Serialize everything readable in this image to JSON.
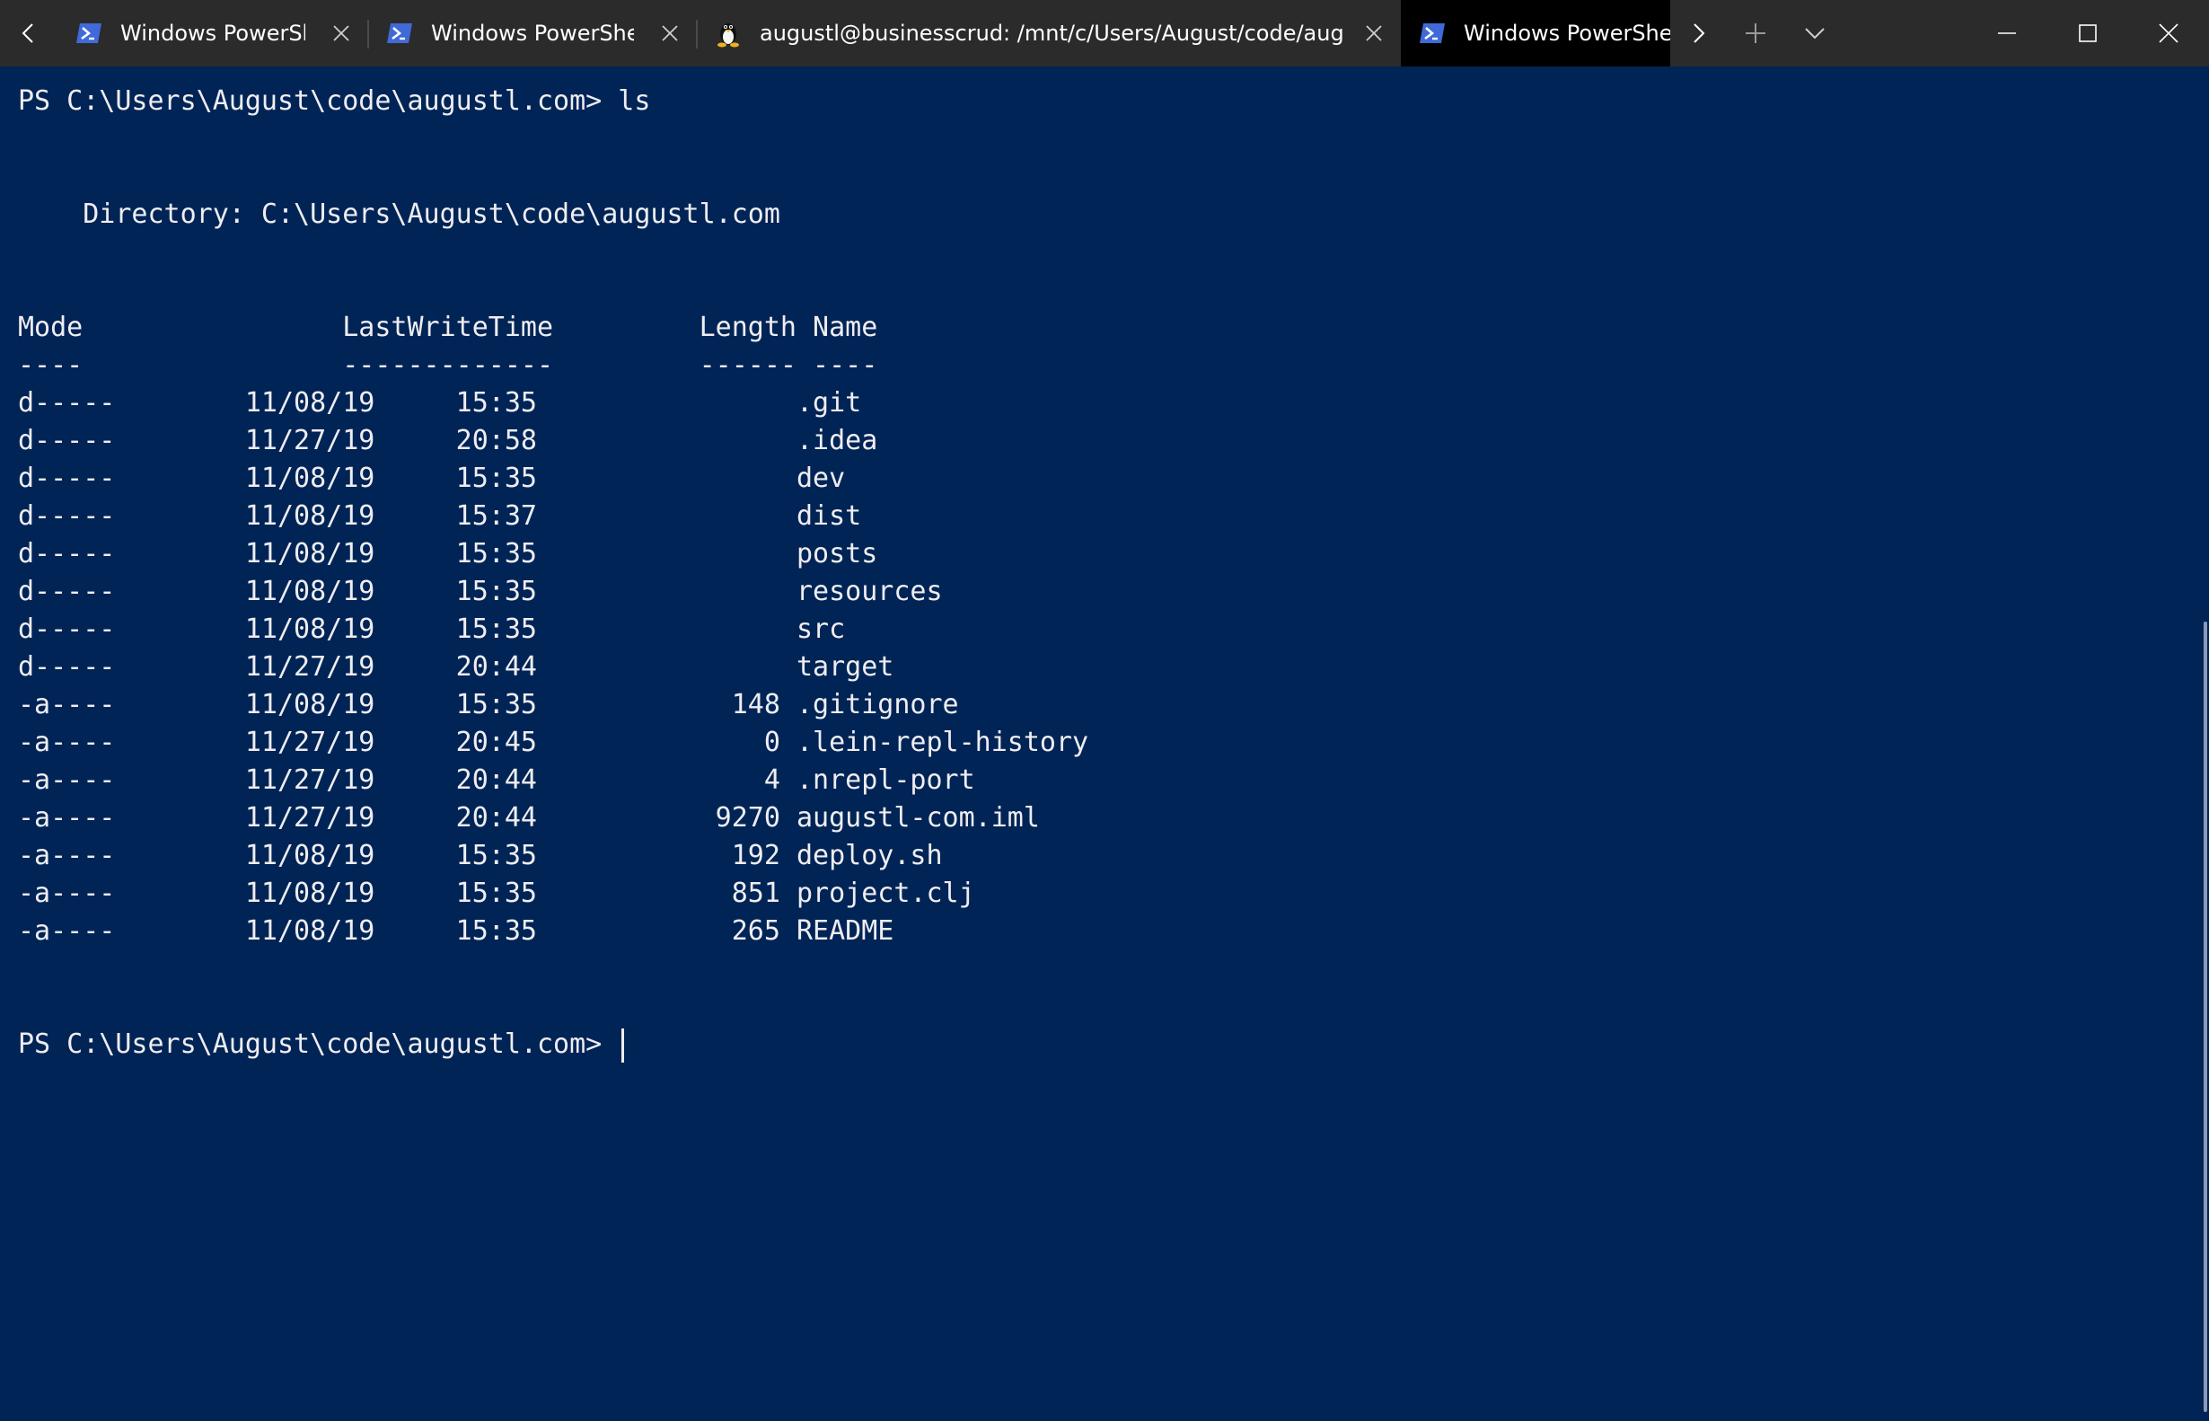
{
  "tabs": [
    {
      "title": "Windows PowerShell",
      "icon": "powershell-icon",
      "active": false
    },
    {
      "title": "Windows PowerShell",
      "icon": "powershell-icon",
      "active": false
    },
    {
      "title": "augustl@businesscrud: /mnt/c/Users/August/code/augustl.com",
      "icon": "linux-tux-icon",
      "active": false
    },
    {
      "title": "Windows PowerShell",
      "icon": "powershell-icon",
      "active": true
    }
  ],
  "colors": {
    "terminal_bg": "#012456",
    "terminal_fg": "#eeedf0",
    "titlebar_bg": "#2b2b2b",
    "active_tab_bg": "#000000",
    "powershell_icon": "#3f6ad8"
  },
  "terminal": {
    "lines": [
      "PS C:\\Users\\August\\code\\augustl.com> ls",
      "",
      "",
      "    Directory: C:\\Users\\August\\code\\augustl.com",
      "",
      "",
      "Mode                LastWriteTime         Length Name",
      "----                -------------         ------ ----",
      "d-----        11/08/19     15:35                .git",
      "d-----        11/27/19     20:58                .idea",
      "d-----        11/08/19     15:35                dev",
      "d-----        11/08/19     15:37                dist",
      "d-----        11/08/19     15:35                posts",
      "d-----        11/08/19     15:35                resources",
      "d-----        11/08/19     15:35                src",
      "d-----        11/27/19     20:44                target",
      "-a----        11/08/19     15:35            148 .gitignore",
      "-a----        11/27/19     20:45              0 .lein-repl-history",
      "-a----        11/27/19     20:44              4 .nrepl-port",
      "-a----        11/27/19     20:44           9270 augustl-com.iml",
      "-a----        11/08/19     15:35            192 deploy.sh",
      "-a----        11/08/19     15:35            851 project.clj",
      "-a----        11/08/19     15:35            265 README",
      "",
      "",
      "PS C:\\Users\\August\\code\\augustl.com> "
    ]
  }
}
